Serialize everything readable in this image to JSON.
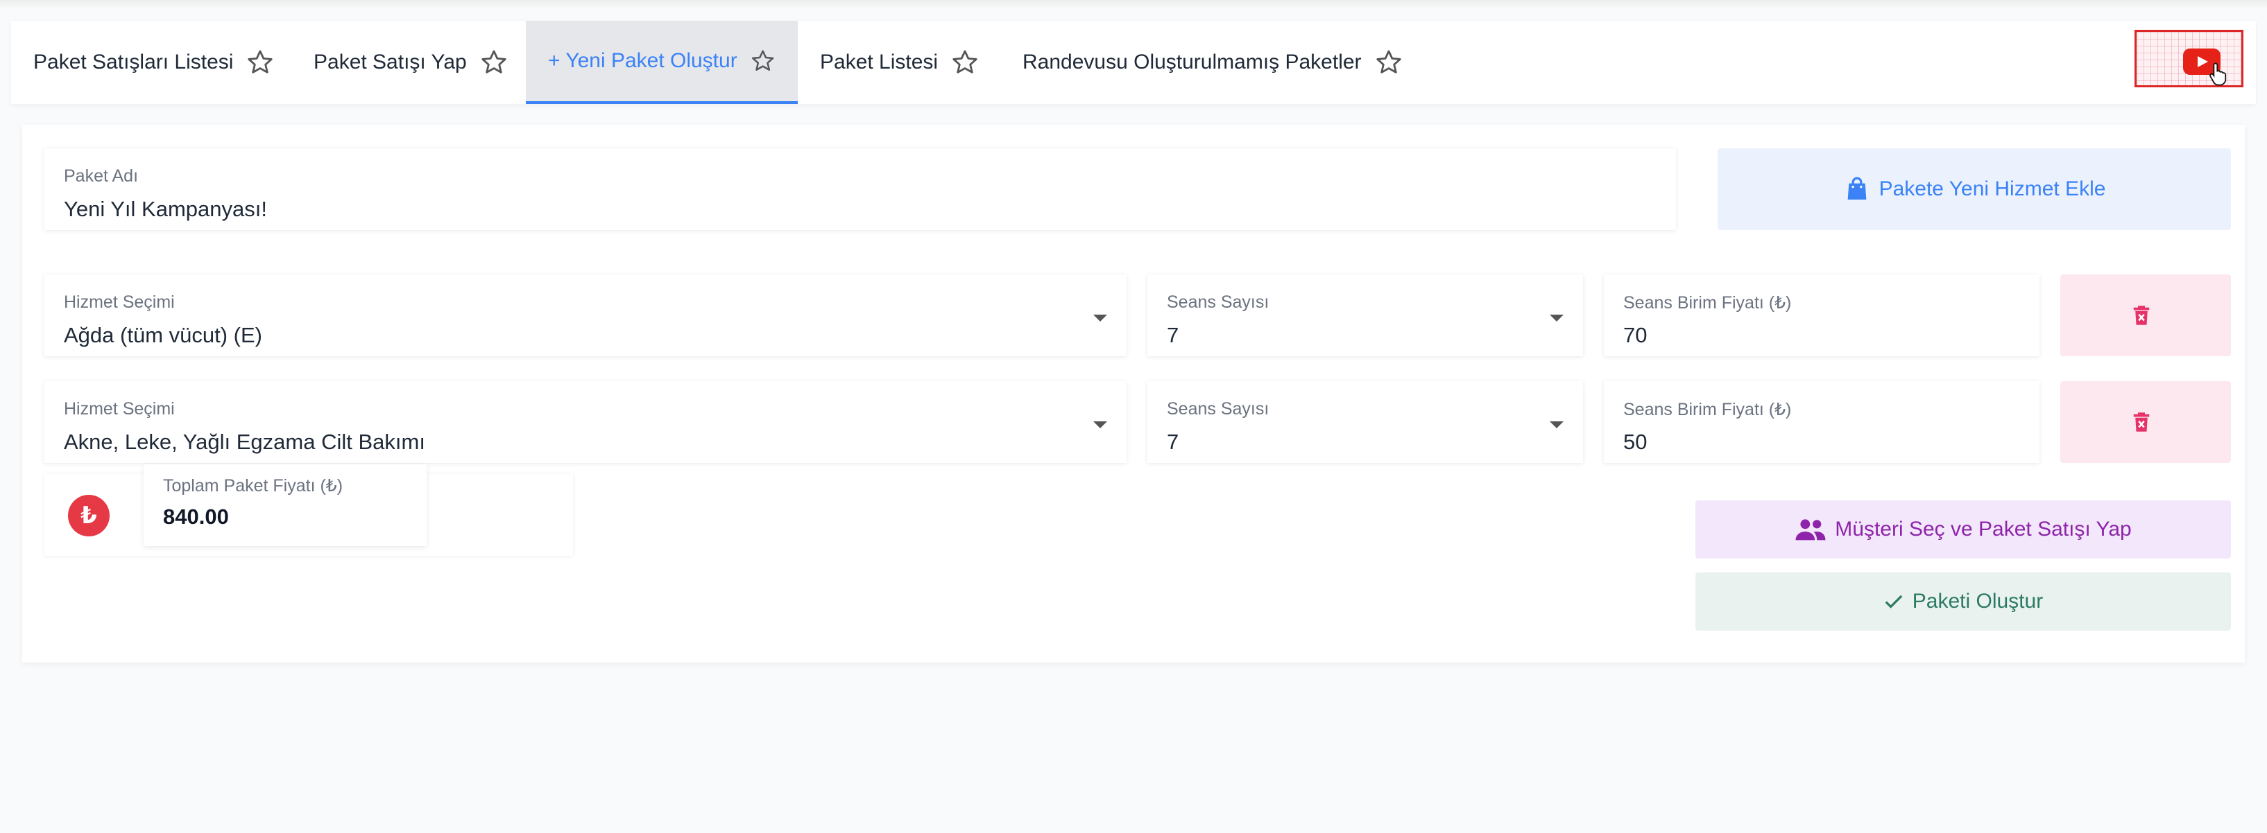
{
  "tabs": [
    {
      "label": "Paket Satışları Listesi",
      "active": false
    },
    {
      "label": "Paket Satışı Yap",
      "active": false
    },
    {
      "label": "+ Yeni Paket Oluştur",
      "active": true
    },
    {
      "label": "Paket Listesi",
      "active": false
    },
    {
      "label": "Randevusu Oluşturulmamış Paketler",
      "active": false
    }
  ],
  "package_name": {
    "label": "Paket Adı",
    "value": "Yeni Yıl Kampanyası!"
  },
  "add_service_button": "Pakete Yeni Hizmet Ekle",
  "services": [
    {
      "service_label": "Hizmet Seçimi",
      "service_value": "Ağda (tüm vücut) (E)",
      "sessions_label": "Seans Sayısı",
      "sessions_value": "7",
      "price_label": "Seans Birim Fiyatı (₺)",
      "price_value": "70"
    },
    {
      "service_label": "Hizmet Seçimi",
      "service_value": "Akne, Leke, Yağlı Egzama Cilt Bakımı",
      "sessions_label": "Seans Sayısı",
      "sessions_value": "7",
      "price_label": "Seans Birim Fiyatı (₺)",
      "price_value": "50"
    }
  ],
  "total": {
    "symbol": "₺",
    "label": "Toplam Paket Fiyatı (₺)",
    "value": "840.00"
  },
  "sell_button": "Müşteri Seç ve Paket Satışı Yap",
  "create_button": "Paketi Oluştur",
  "colors": {
    "accent": "#3b82f6",
    "danger": "#e53945",
    "purple": "#8e24aa",
    "green": "#2c7a63"
  },
  "icons": {
    "tab": "star-outline-icon",
    "add": "shopping-bag-icon",
    "delete": "trash-icon",
    "sell": "people-icon",
    "create": "check-icon",
    "help": "youtube-icon"
  }
}
